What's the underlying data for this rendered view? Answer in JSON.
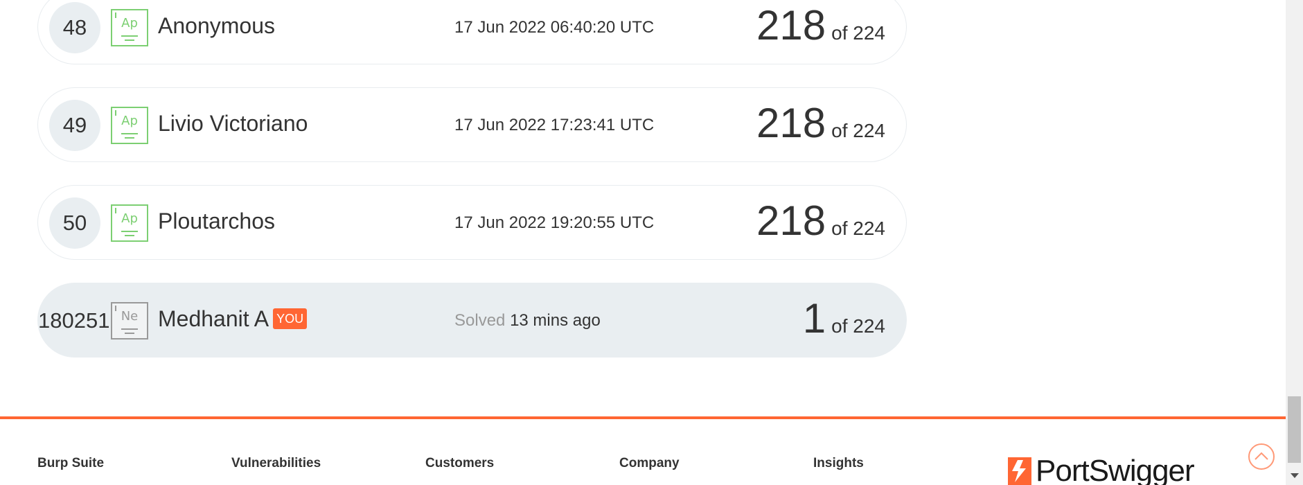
{
  "leaderboard": {
    "rows": [
      {
        "rank": "48",
        "level": "Ap",
        "name": "Anonymous",
        "date": "17 Jun 2022 06:40:20 UTC",
        "score": "218",
        "total": "of 224"
      },
      {
        "rank": "49",
        "level": "Ap",
        "name": "Livio Victoriano",
        "date": "17 Jun 2022 17:23:41 UTC",
        "score": "218",
        "total": "of 224"
      },
      {
        "rank": "50",
        "level": "Ap",
        "name": "Ploutarchos",
        "date": "17 Jun 2022 19:20:55 UTC",
        "score": "218",
        "total": "of 224"
      }
    ],
    "me": {
      "rank": "180251",
      "level": "Ne",
      "name": "Medhanit A",
      "badge": "YOU",
      "solved_label": "Solved",
      "solved_time": "13 mins ago",
      "score": "1",
      "total": "of 224"
    }
  },
  "colors": {
    "accent": "#ff6633",
    "level_green": "#7ccf72",
    "row_highlight": "#e9eef1"
  },
  "footer": {
    "columns": [
      "Burp Suite",
      "Vulnerabilities",
      "Customers",
      "Company",
      "Insights"
    ],
    "logo_text": "PortSwigger",
    "scroll_top_icon": "chevron-up-circle-icon"
  }
}
